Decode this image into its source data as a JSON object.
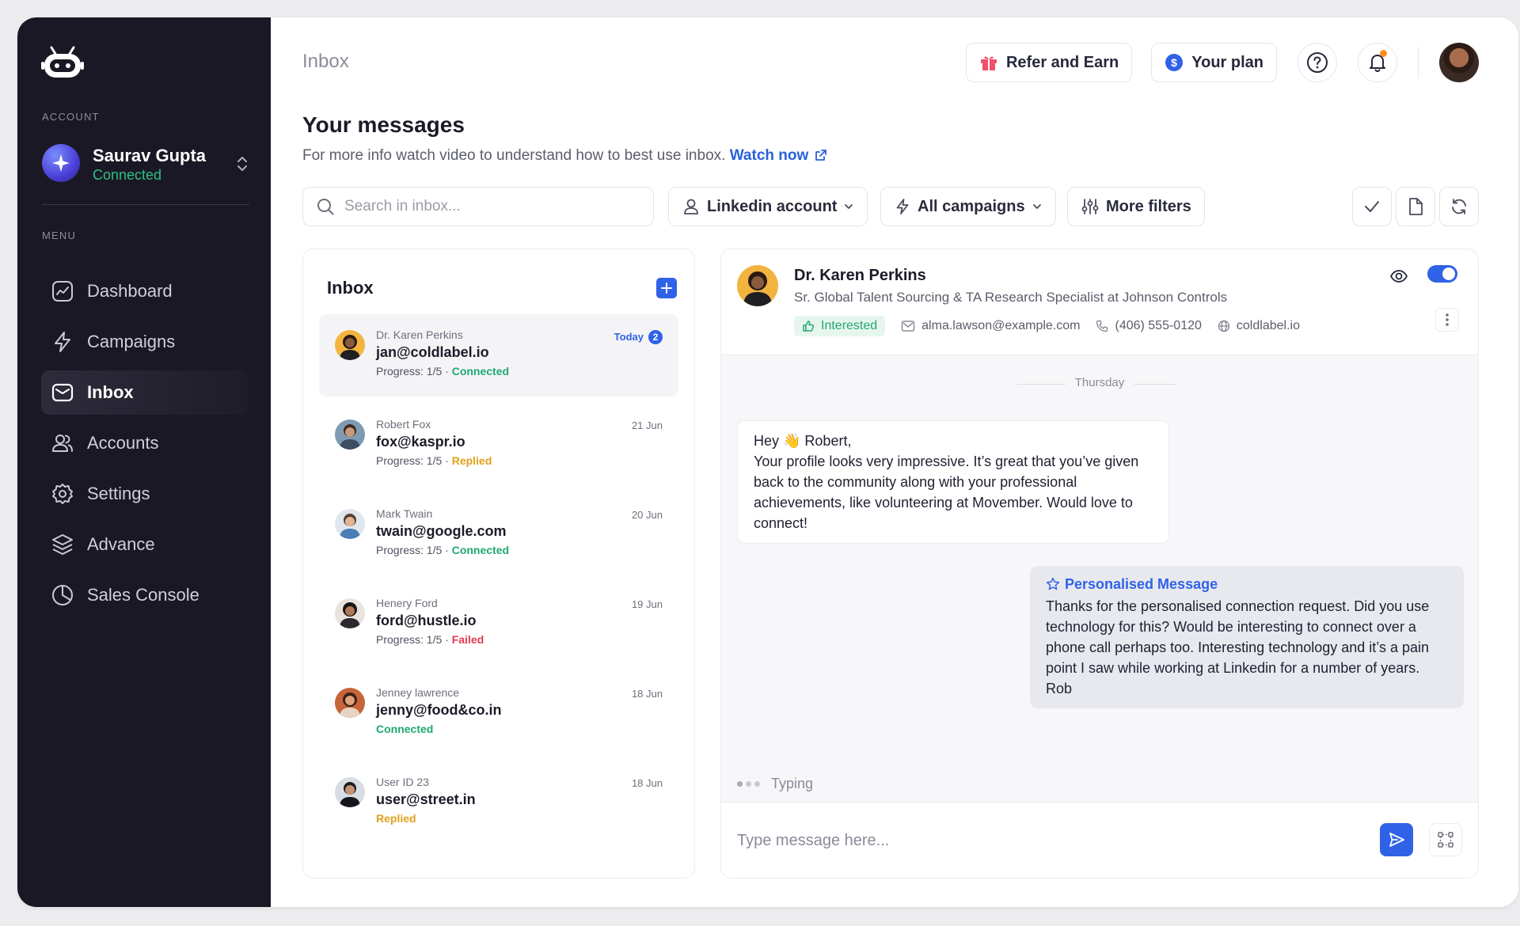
{
  "sidebar": {
    "account_label": "ACCOUNT",
    "account_name": "Saurav Gupta",
    "account_status": "Connected",
    "menu_label": "MENU",
    "items": [
      {
        "label": "Dashboard",
        "icon": "dashboard-icon"
      },
      {
        "label": "Campaigns",
        "icon": "lightning-icon"
      },
      {
        "label": "Inbox",
        "icon": "mail-icon",
        "active": true
      },
      {
        "label": "Accounts",
        "icon": "users-icon"
      },
      {
        "label": "Settings",
        "icon": "gear-icon"
      },
      {
        "label": "Advance",
        "icon": "layers-icon"
      },
      {
        "label": "Sales Console",
        "icon": "pie-chart-icon"
      }
    ]
  },
  "header": {
    "breadcrumb": "Inbox",
    "refer_label": "Refer and Earn",
    "plan_label": "Your plan"
  },
  "page": {
    "title": "Your messages",
    "subtitle": "For more info watch video to understand how to best use inbox.",
    "watch_link": "Watch now"
  },
  "filters": {
    "search_placeholder": "Search in inbox...",
    "linkedin_label": "Linkedin account",
    "campaigns_label": "All campaigns",
    "more_label": "More filters"
  },
  "inbox": {
    "title": "Inbox",
    "threads": [
      {
        "name": "Dr. Karen Perkins",
        "email": "jan@coldlabel.io",
        "progress": "Progress: 1/5 · ",
        "status": "Connected",
        "date": "Today",
        "unread": "2"
      },
      {
        "name": "Robert Fox",
        "email": "fox@kaspr.io",
        "progress": "Progress: 1/5 · ",
        "status": "Replied",
        "date": "21 Jun"
      },
      {
        "name": "Mark Twain",
        "email": "twain@google.com",
        "progress": "Progress: 1/5 · ",
        "status": "Connected",
        "date": "20 Jun"
      },
      {
        "name": "Henery Ford",
        "email": "ford@hustle.io",
        "progress": "Progress: 1/5 · ",
        "status": "Failed",
        "date": "19 Jun"
      },
      {
        "name": "Jenney lawrence",
        "email": "jenny@food&co.in",
        "progress": "",
        "status": "Connected",
        "date": "18 Jun"
      },
      {
        "name": "User ID 23",
        "email": "user@street.in",
        "progress": "",
        "status": "Replied",
        "date": "18 Jun"
      }
    ]
  },
  "conversation": {
    "name": "Dr. Karen Perkins",
    "title": "Sr. Global Talent Sourcing & TA Research Specialist at Johnson Controls",
    "tag": "Interested",
    "email": "alma.lawson@example.com",
    "phone": "(406) 555-0120",
    "website": "coldlabel.io",
    "day": "Thursday",
    "incoming_greeting": "Hey 👋 Robert,",
    "incoming_body": "Your profile looks very impressive. It’s great that you’ve given back to the community along with your professional achievements, like volunteering at Movember. Would love to connect!",
    "outgoing_label": "Personalised Message",
    "outgoing_body": "Thanks for the personalised connection request. Did you use technology for this? Would be interesting to connect over a phone call perhaps too. Interesting technology and it’s a pain point I saw while working at Linkedin for a number of years. Rob",
    "typing": "Typing",
    "compose_placeholder": "Type message here..."
  },
  "colors": {
    "sidebar_bg": "#1a1824",
    "accent": "#2f62e6",
    "connected": "#1fa870",
    "replied": "#e0a11c",
    "failed": "#e0394f"
  }
}
